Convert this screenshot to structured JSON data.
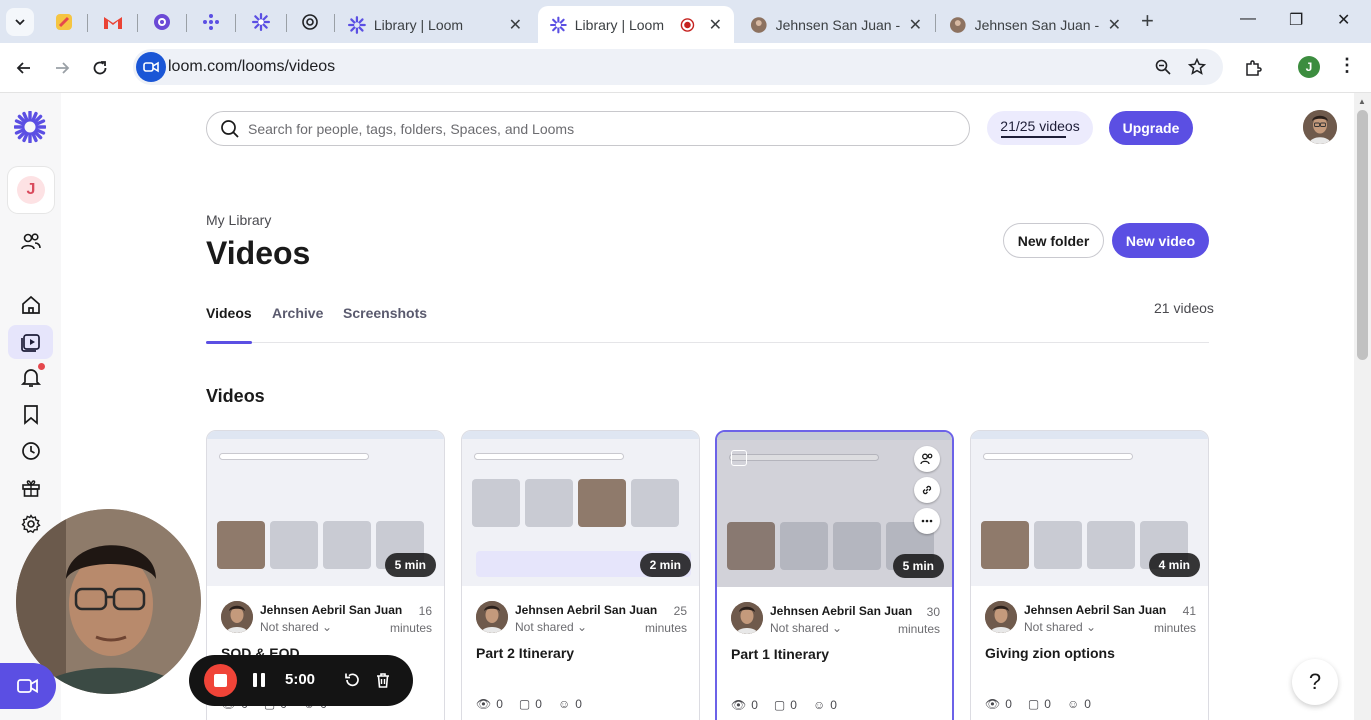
{
  "browser": {
    "tabs": [
      {
        "title": "Library | Loom",
        "active": false
      },
      {
        "title": "Library | Loom",
        "active": true
      },
      {
        "title": "Jehnsen San Juan - At",
        "active": false
      },
      {
        "title": "Jehnsen San Juan - At",
        "active": false
      }
    ],
    "url": "loom.com/looms/videos",
    "profile_initial": "J"
  },
  "rail": {
    "workspace_initial": "J"
  },
  "header": {
    "search_placeholder": "Search for people, tags, folders, Spaces, and Looms",
    "quota": "21/25 videos",
    "upgrade": "Upgrade"
  },
  "page": {
    "breadcrumb": "My Library",
    "title": "Videos",
    "new_folder": "New folder",
    "new_video": "New video",
    "tabs": [
      "Videos",
      "Archive",
      "Screenshots"
    ],
    "count": "21 videos",
    "section": "Videos"
  },
  "cards": [
    {
      "duration": "5 min",
      "owner": "Jehnsen Aebril San Juan",
      "when": "16 minutes",
      "sharing": "Not shared",
      "title": "SOD & EOD",
      "views": "0",
      "comments": "0",
      "reactions": "0"
    },
    {
      "duration": "2 min",
      "owner": "Jehnsen Aebril San Juan",
      "when": "25 minutes",
      "sharing": "Not shared",
      "title": "Part 2 Itinerary",
      "views": "0",
      "comments": "0",
      "reactions": "0"
    },
    {
      "duration": "5 min",
      "owner": "Jehnsen Aebril San Juan",
      "when": "30 minutes",
      "sharing": "Not shared",
      "title": "Part 1 Itinerary",
      "views": "0",
      "comments": "0",
      "reactions": "0"
    },
    {
      "duration": "4 min",
      "owner": "Jehnsen Aebril San Juan",
      "when": "41 minutes",
      "sharing": "Not shared",
      "title": "Giving zion options",
      "views": "0",
      "comments": "0",
      "reactions": "0"
    }
  ],
  "recorder": {
    "timer": "5:00"
  },
  "help": "?",
  "colors": {
    "accent": "#5b4fe3",
    "stop": "#f04438"
  }
}
